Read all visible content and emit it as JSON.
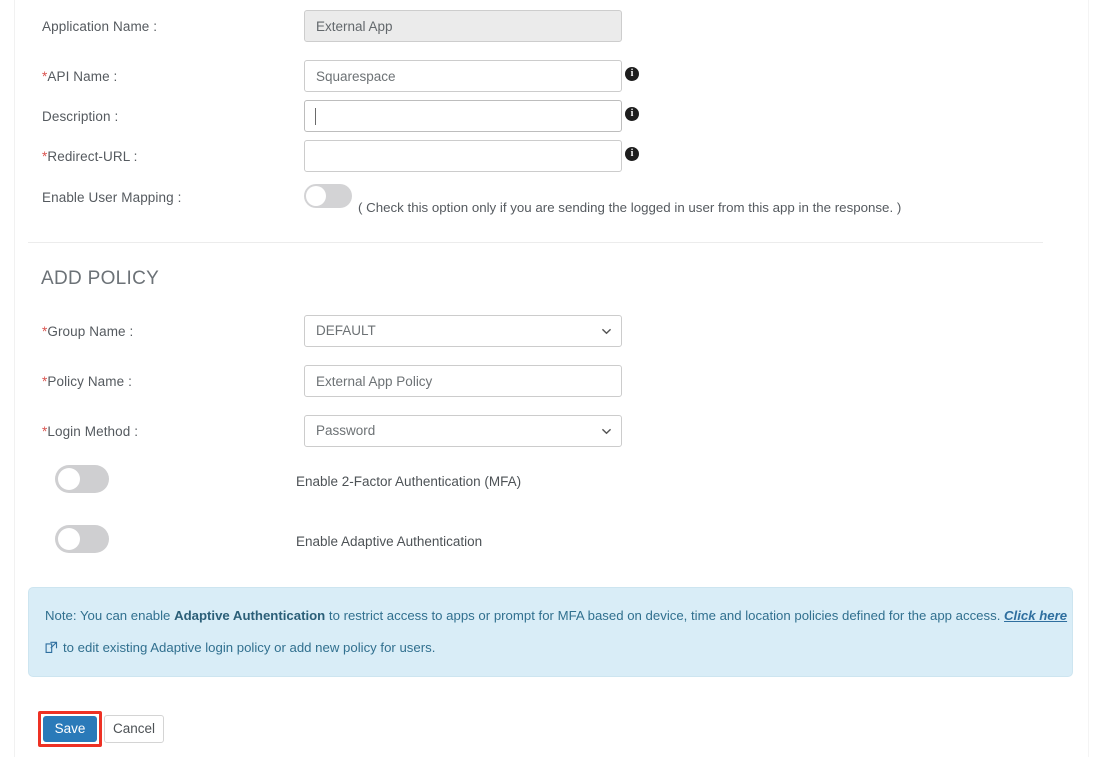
{
  "app_form": {
    "fields": [
      {
        "label": "Application Name :",
        "required": false,
        "value": "External App",
        "placeholder": "",
        "disabled": true,
        "has_info": false,
        "control": "text"
      },
      {
        "label": "API Name :",
        "required": true,
        "value": "Squarespace",
        "placeholder": "",
        "disabled": false,
        "has_info": true,
        "control": "text"
      },
      {
        "label": "Description :",
        "required": false,
        "value": "",
        "placeholder": "",
        "disabled": false,
        "has_info": true,
        "control": "text",
        "focused": true
      },
      {
        "label": "Redirect-URL :",
        "required": true,
        "value": "",
        "placeholder": "",
        "disabled": false,
        "has_info": true,
        "control": "text"
      }
    ],
    "user_mapping": {
      "label": "Enable User Mapping :",
      "toggle_state": "off",
      "hint": "( Check this option only if you are sending the logged in user from this app in the response. )"
    }
  },
  "add_policy": {
    "title": "ADD POLICY",
    "group_name": {
      "label": "Group Name :",
      "required": true,
      "value": "DEFAULT",
      "options": [
        "DEFAULT"
      ],
      "control": "select"
    },
    "policy_name": {
      "label": "Policy Name :",
      "required": true,
      "value": "External App Policy",
      "control": "text"
    },
    "login_method": {
      "label": "Login Method :",
      "required": true,
      "value": "Password",
      "options": [
        "Password"
      ],
      "control": "select"
    },
    "toggles": [
      {
        "label": "Enable 2-Factor Authentication (MFA)",
        "state": "off"
      },
      {
        "label": "Enable Adaptive Authentication",
        "state": "off"
      }
    ]
  },
  "note": {
    "line1_prefix": "Note: You can enable ",
    "line1_bold": "Adaptive Authentication",
    "line1_mid": " to restrict access to apps or prompt for MFA based on device, time and location policies defined for the app access. ",
    "line1_link": "Click here",
    "line2": "to edit existing Adaptive login policy or add new policy for users.",
    "icon": "external-link-icon"
  },
  "actions": {
    "save_label": "Save",
    "cancel_label": "Cancel"
  },
  "colors": {
    "primary_button": "#2a7ab9",
    "highlight_border": "#ee3124",
    "note_background": "#d9edf7",
    "note_text": "#31708f",
    "required_asterisk": "#d9534f",
    "toggle_off": "#d3d3d5"
  }
}
